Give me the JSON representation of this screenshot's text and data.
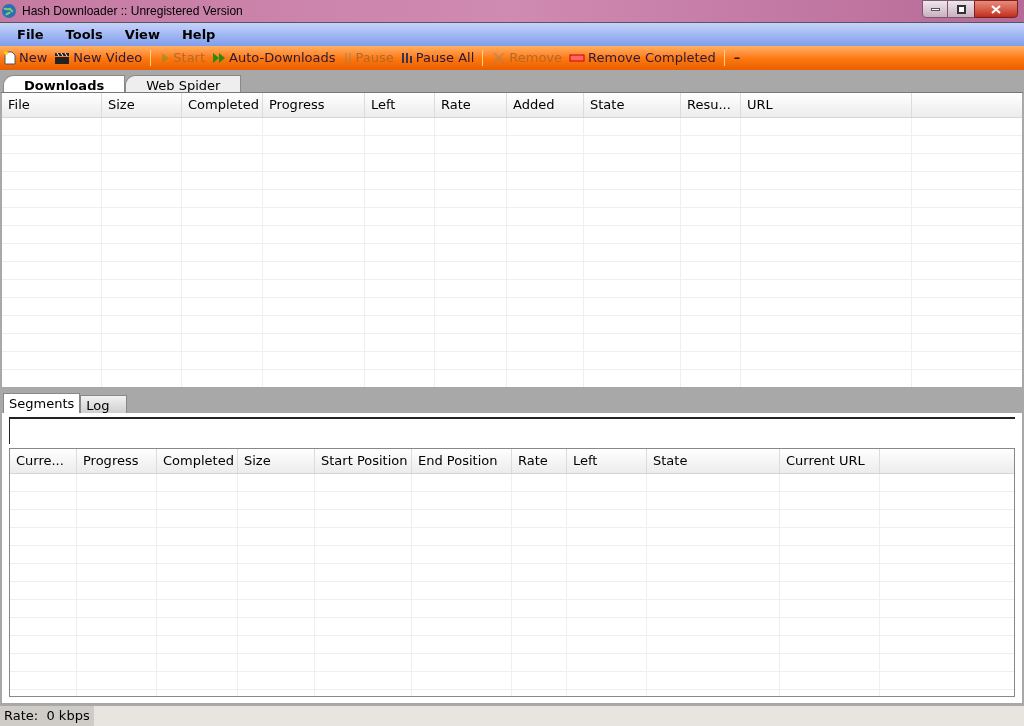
{
  "window": {
    "title": "Hash Downloader :: Unregistered Version"
  },
  "menu": [
    "File",
    "Tools",
    "View",
    "Help"
  ],
  "toolbar": [
    {
      "label": "New",
      "disabled": false
    },
    {
      "label": "New Video",
      "disabled": false
    },
    {
      "label": "Start",
      "disabled": true
    },
    {
      "label": "Auto-Downloads",
      "disabled": false
    },
    {
      "label": "Pause",
      "disabled": true
    },
    {
      "label": "Pause All",
      "disabled": false
    },
    {
      "label": "Remove",
      "disabled": true
    },
    {
      "label": "Remove Completed",
      "disabled": false
    },
    {
      "label": "–",
      "disabled": false
    }
  ],
  "tabs": [
    {
      "label": "Downloads",
      "selected": true
    },
    {
      "label": "Web Spider",
      "selected": false
    }
  ],
  "downloads_table": {
    "columns": [
      "File",
      "Size",
      "Completed",
      "Progress",
      "Left",
      "Rate",
      "Added",
      "State",
      "Resu...",
      "URL"
    ]
  },
  "detail_tabs": [
    {
      "label": "Segments",
      "selected": true
    },
    {
      "label": "Log",
      "selected": false
    }
  ],
  "segments_table": {
    "columns": [
      "Curre...",
      "Progress",
      "Completed",
      "Size",
      "Start Position",
      "End Position",
      "Rate",
      "Left",
      "State",
      "Current URL"
    ]
  },
  "status_bar": {
    "rate": "Rate:  0 kbps"
  }
}
